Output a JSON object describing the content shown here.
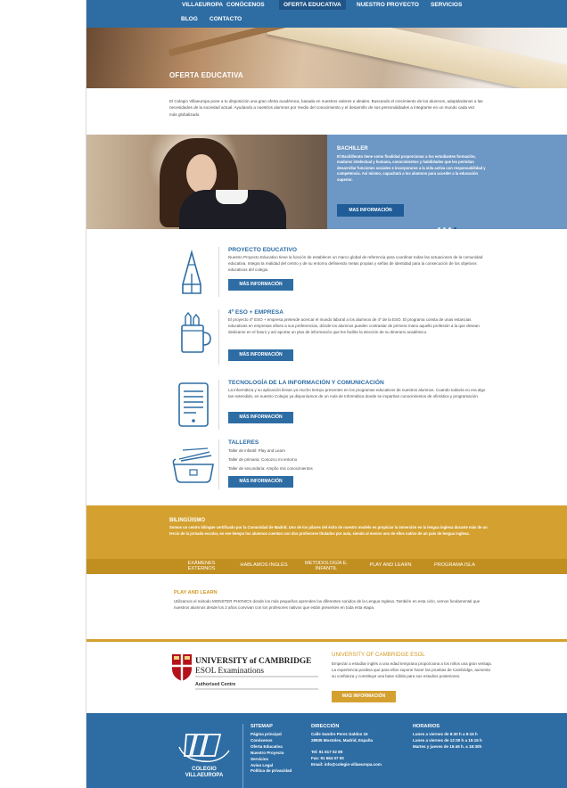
{
  "nav": {
    "items": [
      {
        "label": "VILLAEUROPA"
      },
      {
        "label": "CONÓCENOS"
      },
      {
        "label": "OFERTA EDUCATIVA",
        "active": true
      },
      {
        "label": "NUESTRO PROYECTO"
      },
      {
        "label": "SERVICIOS"
      },
      {
        "label": "BLOG"
      },
      {
        "label": "CONTACTO"
      }
    ]
  },
  "hero": {
    "title": "OFERTA EDUCATIVA"
  },
  "intro": "El Colegio Villaeuropa pone a tu disposición una gran oferta académica, basada en nuestros valores e ideales. Buscando el crecimiento de los alumnos, adaptándonos a las necesidades de la sociedad actual. Ayudando a nuestros alumnos por medio del conocimiento y el desarrollo de sus personalidades a integrarse en un mundo cada vez más globalizado.",
  "slider": {
    "title": "BACHILLER",
    "text": "El Bachillerato tiene como finalidad proporcionar a los estudiantes formación, madurez intelectual y humana, conocimientos y habilidades que les permitan desarrollar funciones sociales e incorporarse a la vida activa con responsabilidad y competencia. Así mismo, capacitará a los alumnos para acceder a la educación superior.",
    "button": "MAS INFORMACIÓN"
  },
  "features": [
    {
      "title": "PROYECTO EDUCATIVO",
      "icon": "pencil-icon",
      "text": "Nuestro Proyecto Educativo tiene la función de establecer un marco global de referencia para coordinar todas las actuaciones de la comunidad educativa. Integra la realidad del centro y de su entorno definiendo metas propias y señas de identidad para la consecución de los objetivos educativos del colegio.",
      "button": "MÁS INFORMACIÓN"
    },
    {
      "title": "4º ESO + EMPRESA",
      "icon": "pencil-cup-icon",
      "text": "El proyecto 4º ESO + empresa pretende acercar el mundo laboral a los alumnos de 4º de la ESO. El programa consta de unas estancias educativas en empresas afines a sus preferencias, dónde los alumnos pueden contrastar de primera mano aquello profesión a la que desean dedicarse en el futuro y así aportar un plus de información que les facilite la elección de su itinerario académico.",
      "button": "MÁS INFORMACIÓN"
    },
    {
      "title": "TECNOLOGÍA DE LA INFORMACIÓN Y COMUNICACIÓN",
      "icon": "tablet-icon",
      "text": "La informática y su aplicación llevan ya mucho tiempo presentes en los programas educativos de nuestros alumnos. Cuando todavía no era algo tan extendido, en nuestro Colegio ya disponíamos de un Aula de Informática donde se impartían conocimientos de ofimática y programación.",
      "button": "MÁS INFORMACIÓN"
    },
    {
      "title": "TALLERES",
      "icon": "pencil-case-icon",
      "lines": [
        "Taller de infantil: Play and Learn",
        "Taller de primaria: Conozco mi entorno",
        "Taller de secundaria: Amplío mis conocimientos"
      ],
      "button": "MÁS INFORMACIÓN"
    }
  ],
  "bilinguismo": {
    "title": "BILINGÜISMO",
    "text": "Somos un centro bilingüe certificado por la Comunidad de Madrid. Uno de los pilares del éxito de nuestro modelo es propiciar la inmersión en la lengua inglesa durante más de un tercio de la jornada escolar, en ese tiempo los alumnos cuentan con dos profesores titulados por aula, siendo al menos uno de ellos nativo de un país de lengua inglesa.",
    "tabs": [
      {
        "label": "EXÁMENES EXTERNOS"
      },
      {
        "label": "HABLAMOS INGLÉS"
      },
      {
        "label": "METODOLOGÍA E. INFANTIL"
      },
      {
        "label": "PLAY AND LEARN"
      },
      {
        "label": "PROGRAMA ISLA"
      }
    ]
  },
  "play_and_learn": {
    "title": "PLAY AND LEARN",
    "text": "Utilizamos el método MONSTER PHONICS donde los más pequeños aprenden los diferentes sonidos de la Lengua Inglesa. También en esta ciclo, vemos fundamental que nuestros alumnos desde los 2 años convivan con los profesores nativos que están presentes en toda esta etapa."
  },
  "cambridge": {
    "logo_line1": "UNIVERSITY of CAMBRIDGE",
    "logo_line2": "ESOL Examinations",
    "logo_line3": "Authorised Centre",
    "title": "UNIVERSITY OF CAMBRIDGE ESOL",
    "text": "Empezar a estudiar inglés a una edad temprana proporciona a los niños una gran ventaja. La experiencia positiva que para ellos supone hacer las pruebas de Cambridge, aumenta su confianza y constituye una base sólida para sus estudios posteriores.",
    "button": "MAS INFORMACIÓN"
  },
  "footer": {
    "logo_name": "COLEGIO VILLAEUROPA",
    "sitemap": {
      "title": "SITEMAP",
      "links": [
        "Página principal",
        "Conócenos",
        "Oferta Educativa",
        "Nuestro Proyecto",
        "Servicios",
        "Aviso Legal",
        "Política de privacidad"
      ]
    },
    "direccion": {
      "title": "DIRECCIÓN",
      "lines": [
        "Calle Sandro Perez Galdos 15",
        "28935 Mostoles, Madrid, España",
        "",
        "Tel: 91 617 02 89",
        "Fax: 91 664 07 00",
        "Email: info@colegio-villaeuropa.com"
      ]
    },
    "horarios": {
      "title": "HORARIOS",
      "lines": [
        "Lunes a viernes de 8:30 h a 9:15 h",
        "Lunes a viernes de 12:30 h a 15:15 h",
        "Martes y jueves de 15:45 h. a 18:30h"
      ]
    }
  },
  "colors": {
    "blue": "#2e6da4",
    "gold": "#d4a130"
  }
}
